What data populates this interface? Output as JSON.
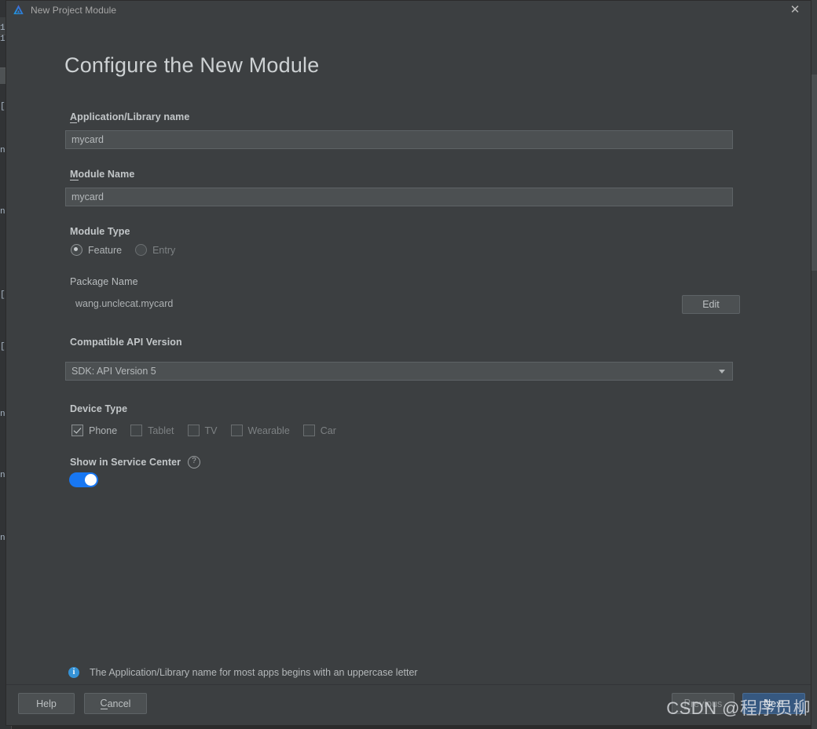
{
  "window": {
    "title": "New Project Module",
    "logo_icon": "deveco-triangle-logo",
    "close_icon": "close-icon"
  },
  "page": {
    "heading": "Configure the New Module"
  },
  "fields": {
    "app_name": {
      "label": "Application/Library name",
      "mnemonic": "A",
      "value": "mycard",
      "placeholder": "mycard"
    },
    "module_name": {
      "label": "Module Name",
      "mnemonic": "M",
      "value": "mycard",
      "placeholder": "mycard"
    },
    "module_type": {
      "label": "Module Type",
      "options": [
        {
          "label": "Feature",
          "selected": true
        },
        {
          "label": "Entry",
          "selected": false
        }
      ]
    },
    "package_name": {
      "label": "Package Name",
      "value": "wang.unclecat.mycard",
      "edit_button": "Edit"
    },
    "api_version": {
      "label": "Compatible API Version",
      "selected": "SDK: API Version 5",
      "dropdown_icon": "chevron-down-icon"
    },
    "device_type": {
      "label": "Device Type",
      "options": [
        {
          "label": "Phone",
          "checked": true,
          "enabled": true
        },
        {
          "label": "Tablet",
          "checked": false,
          "enabled": false
        },
        {
          "label": "TV",
          "checked": false,
          "enabled": false
        },
        {
          "label": "Wearable",
          "checked": false,
          "enabled": false
        },
        {
          "label": "Car",
          "checked": false,
          "enabled": false
        }
      ]
    },
    "service_center": {
      "label": "Show in Service Center",
      "help_icon": "question-mark-icon",
      "help_glyph": "?",
      "enabled": true
    }
  },
  "info": {
    "icon": "info-icon",
    "glyph": "i",
    "message": "The Application/Library name for most apps begins with an uppercase letter"
  },
  "footer": {
    "help_label": "Help",
    "cancel_label": "Cancel",
    "previous_label": "Previous",
    "next_label": "Next"
  },
  "watermark": {
    "text": "CSDN @程序员柳"
  },
  "colors": {
    "dialog_bg": "#3c3f41",
    "input_bg": "#4c5052",
    "accent_toggle": "#1877f2",
    "accent_button": "#365880",
    "info_blue": "#3592d6"
  }
}
